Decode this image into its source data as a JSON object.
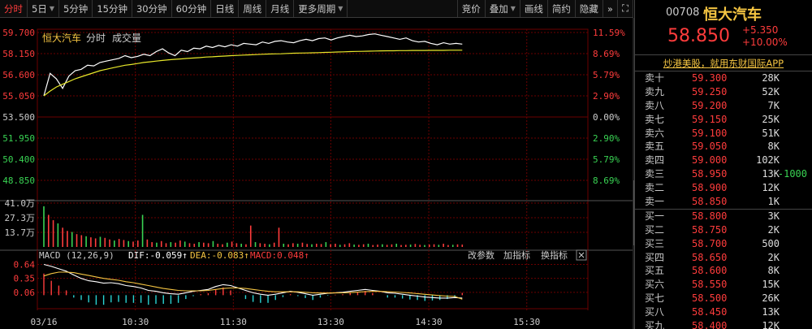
{
  "toolbar": {
    "items": [
      {
        "label": "分时",
        "active": true
      },
      {
        "label": "5日",
        "arrow": true
      },
      {
        "label": "5分钟"
      },
      {
        "label": "15分钟"
      },
      {
        "label": "30分钟"
      },
      {
        "label": "60分钟"
      },
      {
        "label": "日线"
      },
      {
        "label": "周线"
      },
      {
        "label": "月线"
      },
      {
        "label": "更多周期",
        "arrow": true
      }
    ],
    "right_items": [
      {
        "label": "竞价"
      },
      {
        "label": "叠加",
        "arrow": true
      },
      {
        "label": "画线"
      },
      {
        "label": "简约"
      },
      {
        "label": "隐藏"
      }
    ],
    "scroll_icon": "double-chevron-right-icon",
    "fullscreen_icon": "fullscreen-icon"
  },
  "chart_header": {
    "name": "恒大汽车",
    "tab_time": "分时",
    "tab_volume": "成交量"
  },
  "chart_data": {
    "type": "line",
    "x_ticks": [
      "03/16",
      "10:30",
      "11:30",
      "13:30",
      "14:30",
      "15:30"
    ],
    "y_ticks_left": [
      "59.700",
      "58.150",
      "56.600",
      "55.050",
      "53.500",
      "51.950",
      "50.400",
      "48.850"
    ],
    "y_ticks_right": [
      "11.59%",
      "8.69%",
      "5.79%",
      "2.90%",
      "0.00%",
      "2.90%",
      "5.79%",
      "8.69%"
    ],
    "ylim": [
      48.076,
      59.7
    ],
    "prev_close": 53.5,
    "series": [
      {
        "role": "price",
        "color": "#ffffff",
        "values": [
          55.05,
          56.7,
          56.3,
          55.6,
          56.5,
          56.9,
          57.0,
          57.3,
          57.25,
          57.5,
          57.6,
          57.7,
          57.8,
          58.0,
          57.85,
          57.95,
          58.1,
          58.0,
          58.3,
          58.5,
          58.2,
          58.0,
          58.4,
          58.3,
          58.55,
          58.5,
          58.7,
          58.6,
          58.75,
          58.65,
          58.8,
          58.7,
          58.9,
          58.85,
          58.8,
          59.0,
          58.9,
          59.05,
          59.1,
          59.0,
          58.95,
          59.1,
          59.2,
          59.1,
          59.25,
          59.3,
          59.15,
          59.3,
          59.4,
          59.5,
          59.4,
          59.45,
          59.55,
          59.6,
          59.5,
          59.4,
          59.3,
          59.2,
          59.3,
          59.1,
          59.0,
          59.05,
          58.9,
          58.8,
          58.95,
          58.85,
          58.9,
          58.85
        ]
      },
      {
        "role": "average",
        "color": "#e8e82a",
        "values": [
          55.05,
          55.4,
          55.7,
          55.9,
          56.1,
          56.3,
          56.45,
          56.6,
          56.75,
          56.9,
          57.0,
          57.1,
          57.2,
          57.3,
          57.35,
          57.42,
          57.5,
          57.55,
          57.6,
          57.65,
          57.7,
          57.73,
          57.76,
          57.8,
          57.83,
          57.86,
          57.9,
          57.92,
          57.95,
          57.97,
          58.0,
          58.02,
          58.04,
          58.06,
          58.08,
          58.1,
          58.12,
          58.13,
          58.14,
          58.16,
          58.18,
          58.19,
          58.2,
          58.21,
          58.22,
          58.24,
          58.25,
          58.27,
          58.28,
          58.3,
          58.31,
          58.32,
          58.33,
          58.34,
          58.35,
          58.36,
          58.36,
          58.37,
          58.37,
          58.38,
          58.38,
          58.38,
          58.39,
          58.39,
          58.39,
          58.4,
          58.4,
          58.4
        ]
      }
    ],
    "volume": {
      "y_ticks": [
        "41.0万",
        "27.3万",
        "13.7万"
      ],
      "ylim": [
        0,
        410000
      ],
      "values": [
        380000,
        300000,
        250000,
        220000,
        180000,
        150000,
        140000,
        120000,
        110000,
        100000,
        90000,
        80000,
        95000,
        85000,
        70000,
        60000,
        75000,
        65000,
        55000,
        50000,
        60000,
        300000,
        70000,
        45000,
        40000,
        55000,
        35000,
        45000,
        40000,
        60000,
        50000,
        35000,
        30000,
        45000,
        40000,
        35000,
        55000,
        30000,
        25000,
        40000,
        50000,
        35000,
        30000,
        25000,
        200000,
        45000,
        35000,
        30000,
        25000,
        40000,
        180000,
        30000,
        25000,
        35000,
        30000,
        40000,
        28000,
        25000,
        30000,
        27000,
        45000,
        25000,
        30000,
        20000,
        25000,
        35000,
        22000,
        20000,
        25000,
        30000,
        18000,
        22000,
        25000,
        20000,
        24000,
        30000,
        18000,
        20000,
        22000,
        28000,
        20000,
        18000,
        22000,
        25000,
        20000,
        30000,
        18000,
        20000,
        24000,
        22000
      ],
      "colors": [
        "#ff3c3c",
        "#39d353"
      ]
    },
    "macd": {
      "label": "MACD (12,26,9)",
      "dif_label": "DIF:-0.059↑",
      "dea_label": "DEA:-0.083↑",
      "macd_label": "MACD:0.048↑",
      "y_ticks": [
        "0.64",
        "0.35",
        "0.06"
      ],
      "ylim": [
        -0.18,
        0.7
      ],
      "dif": [
        0.64,
        0.6,
        0.55,
        0.5,
        0.42,
        0.35,
        0.3,
        0.28,
        0.25,
        0.26,
        0.24,
        0.2,
        0.18,
        0.15,
        0.1,
        0.08,
        0.05,
        0.03,
        0.02,
        0.05,
        0.08,
        0.1,
        0.12,
        0.18,
        0.22,
        0.2,
        0.15,
        0.1,
        0.05,
        0.02,
        0.0,
        0.02,
        0.05,
        0.08,
        0.06,
        0.03,
        0.0,
        0.02,
        0.04,
        0.05,
        0.06,
        0.08,
        0.1,
        0.12,
        0.1,
        0.08,
        0.05,
        0.04,
        0.02,
        0.0,
        -0.02,
        -0.04,
        -0.05,
        -0.06,
        -0.06,
        -0.05,
        -0.059
      ],
      "dea": [
        0.4,
        0.45,
        0.48,
        0.48,
        0.47,
        0.44,
        0.41,
        0.38,
        0.35,
        0.33,
        0.31,
        0.28,
        0.26,
        0.23,
        0.2,
        0.17,
        0.14,
        0.12,
        0.1,
        0.09,
        0.09,
        0.09,
        0.1,
        0.12,
        0.14,
        0.15,
        0.15,
        0.14,
        0.12,
        0.1,
        0.08,
        0.07,
        0.07,
        0.07,
        0.07,
        0.06,
        0.05,
        0.045,
        0.045,
        0.046,
        0.048,
        0.054,
        0.063,
        0.074,
        0.079,
        0.079,
        0.073,
        0.066,
        0.057,
        0.046,
        0.033,
        0.018,
        0.004,
        -0.009,
        -0.02,
        -0.026,
        -0.083
      ],
      "hist": [
        0.45,
        0.3,
        0.2,
        0.1,
        -0.05,
        -0.1,
        -0.15,
        -0.2,
        -0.2,
        -0.15,
        -0.14,
        -0.16,
        -0.16,
        -0.16,
        -0.2,
        -0.18,
        -0.18,
        -0.18,
        -0.16,
        -0.08,
        -0.02,
        0.02,
        0.04,
        0.12,
        0.16,
        0.1,
        0.0,
        -0.08,
        -0.14,
        -0.16,
        -0.16,
        -0.1,
        -0.04,
        0.02,
        -0.02,
        -0.06,
        -0.1,
        -0.05,
        -0.01,
        0.01,
        0.02,
        0.05,
        0.07,
        0.09,
        0.04,
        0.0,
        -0.05,
        -0.05,
        -0.07,
        -0.09,
        -0.1,
        -0.12,
        -0.11,
        -0.1,
        -0.08,
        -0.05,
        0.048
      ],
      "params_btn": "改参数",
      "add_btn": "加指标",
      "switch_btn": "换指标",
      "close_icon": "close-icon"
    },
    "colors": {
      "up": "#ff3c3c",
      "down": "#39d353",
      "grid": "#6b0000",
      "axis_down": "#39d353"
    }
  },
  "right_panel": {
    "code": "00708",
    "name": "恒大汽车",
    "price": "58.850",
    "change": "+5.350",
    "change_pct": "+10.00%",
    "ad_text": "炒港美股，就用东财国际APP",
    "asks": [
      {
        "label": "卖十",
        "price": "59.300",
        "vol": "28K",
        "extra": ""
      },
      {
        "label": "卖九",
        "price": "59.250",
        "vol": "52K",
        "extra": ""
      },
      {
        "label": "卖八",
        "price": "59.200",
        "vol": "7K",
        "extra": ""
      },
      {
        "label": "卖七",
        "price": "59.150",
        "vol": "25K",
        "extra": ""
      },
      {
        "label": "卖六",
        "price": "59.100",
        "vol": "51K",
        "extra": ""
      },
      {
        "label": "卖五",
        "price": "59.050",
        "vol": "8K",
        "extra": ""
      },
      {
        "label": "卖四",
        "price": "59.000",
        "vol": "102K",
        "extra": ""
      },
      {
        "label": "卖三",
        "price": "58.950",
        "vol": "13K",
        "extra": "-1000"
      },
      {
        "label": "卖二",
        "price": "58.900",
        "vol": "12K",
        "extra": ""
      },
      {
        "label": "卖一",
        "price": "58.850",
        "vol": "1K",
        "extra": ""
      }
    ],
    "bids": [
      {
        "label": "买一",
        "price": "58.800",
        "vol": "3K",
        "extra": ""
      },
      {
        "label": "买二",
        "price": "58.750",
        "vol": "2K",
        "extra": ""
      },
      {
        "label": "买三",
        "price": "58.700",
        "vol": "500",
        "extra": ""
      },
      {
        "label": "买四",
        "price": "58.650",
        "vol": "2K",
        "extra": ""
      },
      {
        "label": "买五",
        "price": "58.600",
        "vol": "8K",
        "extra": ""
      },
      {
        "label": "买六",
        "price": "58.550",
        "vol": "15K",
        "extra": ""
      },
      {
        "label": "买七",
        "price": "58.500",
        "vol": "26K",
        "extra": ""
      },
      {
        "label": "买八",
        "price": "58.450",
        "vol": "13K",
        "extra": ""
      },
      {
        "label": "买九",
        "price": "58.400",
        "vol": "12K",
        "extra": ""
      }
    ]
  }
}
